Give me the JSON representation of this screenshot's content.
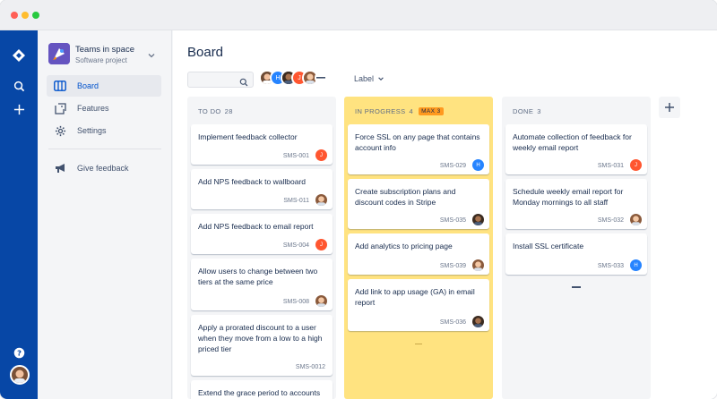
{
  "window": {
    "traffic_lights": [
      "close",
      "minimize",
      "maximize"
    ]
  },
  "global_nav": {
    "icons": [
      "jira-logo-icon",
      "search-icon",
      "plus-icon",
      "help-icon",
      "avatar"
    ]
  },
  "sidebar": {
    "project_name": "Teams in space",
    "project_type": "Software project",
    "items": [
      {
        "label": "Board",
        "icon": "board-icon",
        "active": true
      },
      {
        "label": "Features",
        "icon": "features-icon",
        "active": false
      },
      {
        "label": "Settings",
        "icon": "gear-icon",
        "active": false
      },
      {
        "label": "Give feedback",
        "icon": "megaphone-icon",
        "active": false
      }
    ]
  },
  "main": {
    "title": "Board",
    "search_placeholder": "",
    "avatars": [
      {
        "initial": "",
        "color": "#e8b07d"
      },
      {
        "initial": "H",
        "color": "#2684ff"
      },
      {
        "initial": "",
        "color": "#5e4a3a"
      },
      {
        "initial": "J",
        "color": "#ff5630"
      },
      {
        "initial": "",
        "color": "#d99a7a"
      }
    ],
    "label_filter": "Label"
  },
  "columns": [
    {
      "title": "TO DO",
      "count": "28",
      "max": "",
      "cards": [
        {
          "title": "Implement feedback collector",
          "key": "SMS-001",
          "assignee": "J",
          "color": "#ff5630"
        },
        {
          "title": "Add NPS feedback to wallboard",
          "key": "SMS-011",
          "assignee": "",
          "color": "#e8b07d"
        },
        {
          "title": "Add NPS feedback to email report",
          "key": "SMS-004",
          "assignee": "J",
          "color": "#ff5630"
        },
        {
          "title": "Allow users to change between two tiers at the same price",
          "key": "SMS-008",
          "assignee": "",
          "color": "#e8b07d"
        },
        {
          "title": "Apply a prorated discount to a user when they move from a low to a high priced tier",
          "key": "SMS-0012",
          "assignee": "",
          "color": ""
        },
        {
          "title": "Extend the grace period to accounts",
          "key": "",
          "assignee": "",
          "color": ""
        }
      ]
    },
    {
      "title": "IN PROGRESS",
      "count": "4",
      "max": "MAX 3",
      "cards": [
        {
          "title": "Force SSL on any page that contains account info",
          "key": "SMS-029",
          "assignee": "H",
          "color": "#2684ff"
        },
        {
          "title": "Create subscription plans and discount codes in Stripe",
          "key": "SMS-035",
          "assignee": "",
          "color": "#5e4a3a"
        },
        {
          "title": "Add analytics to pricing page",
          "key": "SMS-039",
          "assignee": "",
          "color": "#e8b07d"
        },
        {
          "title": "Add link to app usage (GA) in email report",
          "key": "SMS-036",
          "assignee": "",
          "color": "#5e4a3a"
        }
      ]
    },
    {
      "title": "DONE",
      "count": "3",
      "max": "",
      "cards": [
        {
          "title": "Automate collection of feedback for weekly email report",
          "key": "SMS-031",
          "assignee": "J",
          "color": "#ff5630"
        },
        {
          "title": "Schedule weekly email report for Monday mornings to all staff",
          "key": "SMS-032",
          "assignee": "",
          "color": "#e8b07d"
        },
        {
          "title": "Install SSL certificate",
          "key": "SMS-033",
          "assignee": "H",
          "color": "#2684ff"
        }
      ]
    }
  ],
  "add_column_icon": "plus-icon"
}
